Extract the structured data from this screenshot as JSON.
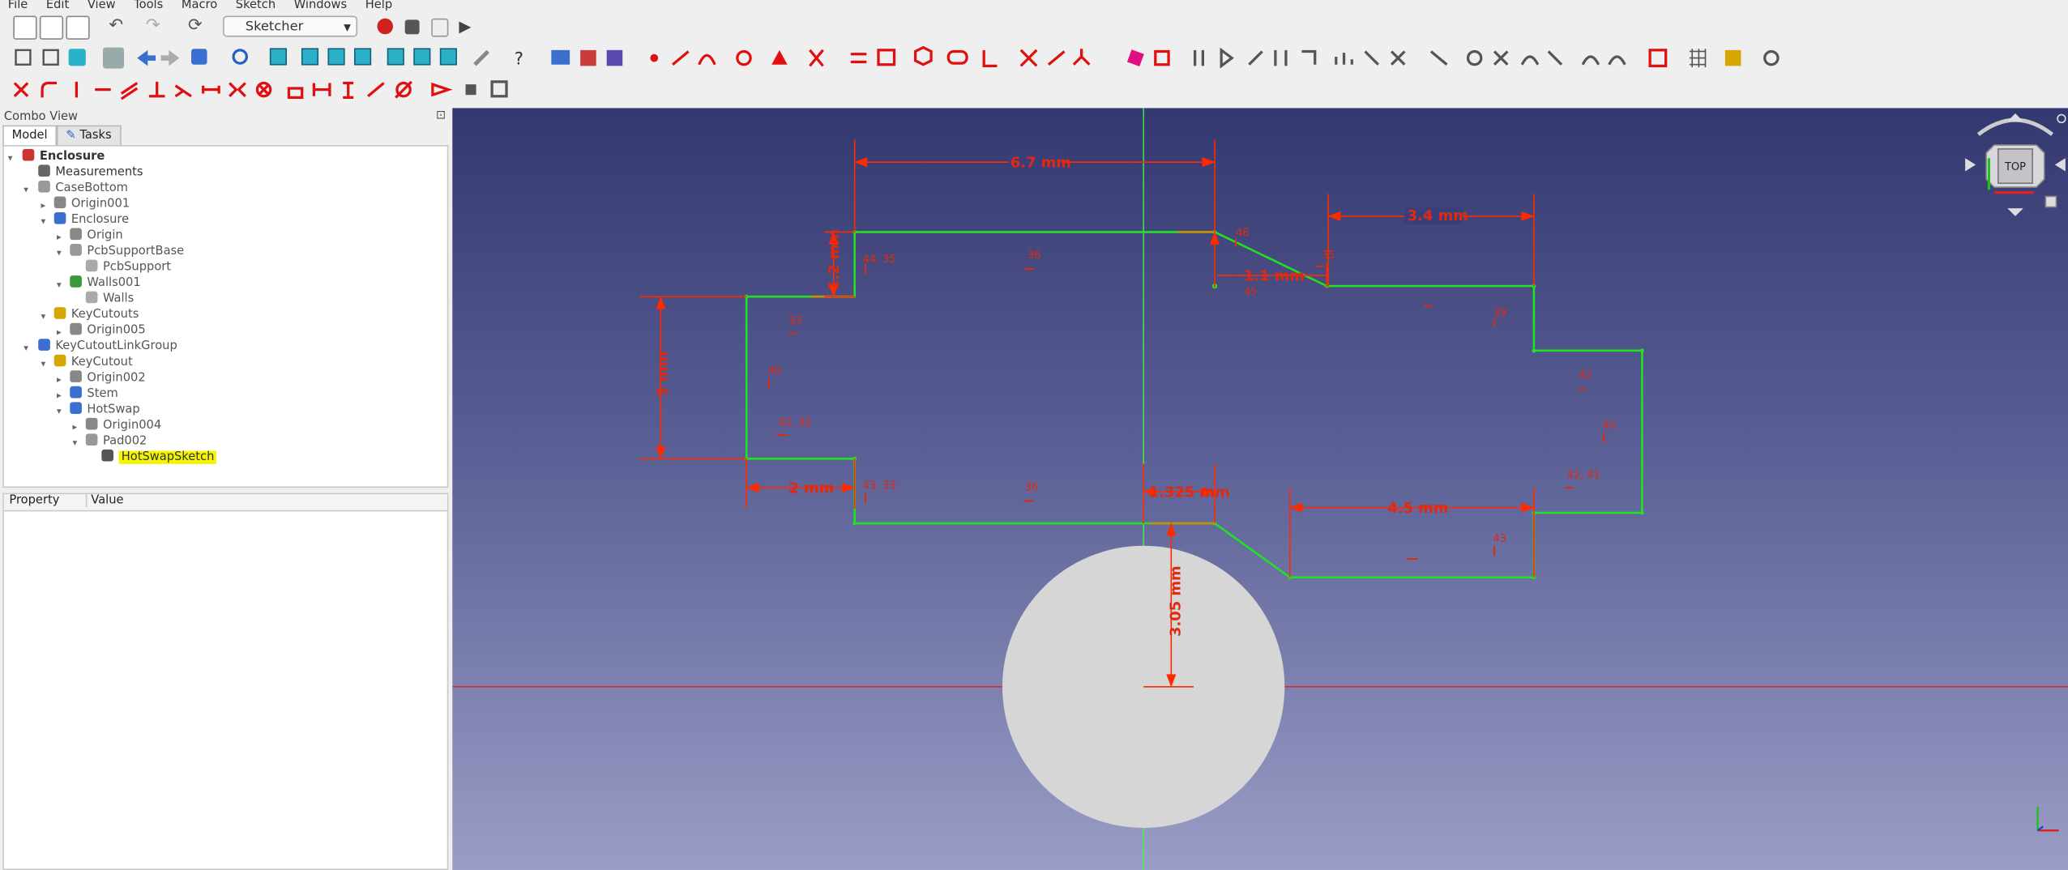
{
  "menu": [
    "File",
    "Edit",
    "View",
    "Tools",
    "Macro",
    "Sketch",
    "Windows",
    "Help"
  ],
  "workbench": "Sketcher",
  "combo": {
    "title": "Combo View",
    "tabs": [
      "Model",
      "Tasks"
    ],
    "tree": [
      {
        "label": "Enclosure",
        "bold": true
      },
      {
        "label": "Measurements"
      },
      {
        "label": "CaseBottom"
      },
      {
        "label": "Origin001"
      },
      {
        "label": "Enclosure"
      },
      {
        "label": "Origin"
      },
      {
        "label": "PcbSupportBase"
      },
      {
        "label": "PcbSupport"
      },
      {
        "label": "Walls001"
      },
      {
        "label": "Walls"
      },
      {
        "label": "KeyCutouts"
      },
      {
        "label": "Origin005"
      },
      {
        "label": "KeyCutoutLinkGroup"
      },
      {
        "label": "KeyCutout"
      },
      {
        "label": "Origin002"
      },
      {
        "label": "Stem"
      },
      {
        "label": "HotSwap"
      },
      {
        "label": "Origin004"
      },
      {
        "label": "Pad002"
      },
      {
        "label": "HotSwapSketch",
        "selected": true
      }
    ],
    "props_headers": [
      "Property",
      "Value"
    ]
  },
  "nav": {
    "face": "TOP"
  },
  "dimensions": {
    "d1": "6.7 mm",
    "d2": "3.4 mm",
    "d3": "1.2 mm",
    "d4": "3 mm",
    "d5": "1.1 mm",
    "d6": "2 mm",
    "d7": "1.325 mm",
    "d8": "4.5 mm",
    "d9": "3.05 mm"
  },
  "constraints": {
    "c1": "44, 35",
    "c2": "36",
    "c3": "46",
    "c4": "35",
    "c5": "33",
    "c6": "40",
    "c7": "42, 32",
    "c8": "43, 33",
    "c9": "36",
    "c10": "45",
    "c11": "39",
    "c12": "41",
    "c13": "40",
    "c14": "42, 41",
    "c15": "43"
  },
  "colors": {
    "sketch_line": "#22e022",
    "constraint": "#ff2a00",
    "background_top": "#343870",
    "background_bottom": "#9a9dc5",
    "circle": "#d6d6d6"
  }
}
